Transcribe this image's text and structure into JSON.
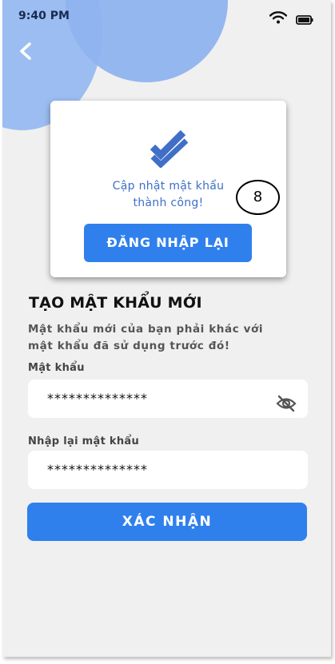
{
  "status_bar": {
    "time": "9:40 PM",
    "wifi_icon": "wifi-icon",
    "battery_icon": "battery-icon"
  },
  "nav": {
    "back_icon": "chevron-left-icon"
  },
  "dialog": {
    "icon": "double-check-icon",
    "message_line1": "Cập nhật mật khẩu",
    "message_line2": "thành công!",
    "button_label": "ĐĂNG NHẬP LẠI"
  },
  "annotation": {
    "number": "8"
  },
  "form": {
    "title": "TẠO MẬT KHẨU MỚI",
    "subtitle_line1": "Mật khẩu mới của bạn phải khác với",
    "subtitle_line2": "mật khẩu đã sử dụng trước đó!",
    "password_label": "Mật khẩu",
    "password_value": "**************",
    "password_toggle_icon": "eye-off-icon",
    "confirm_label": "Nhập lại mật khẩu",
    "confirm_value": "**************",
    "submit_label": "XÁC NHẬN"
  },
  "colors": {
    "primary": "#2f80ed",
    "accent_circle": "#9bbdf1",
    "message_text": "#3f6fc7",
    "background": "#f0f0f0"
  }
}
